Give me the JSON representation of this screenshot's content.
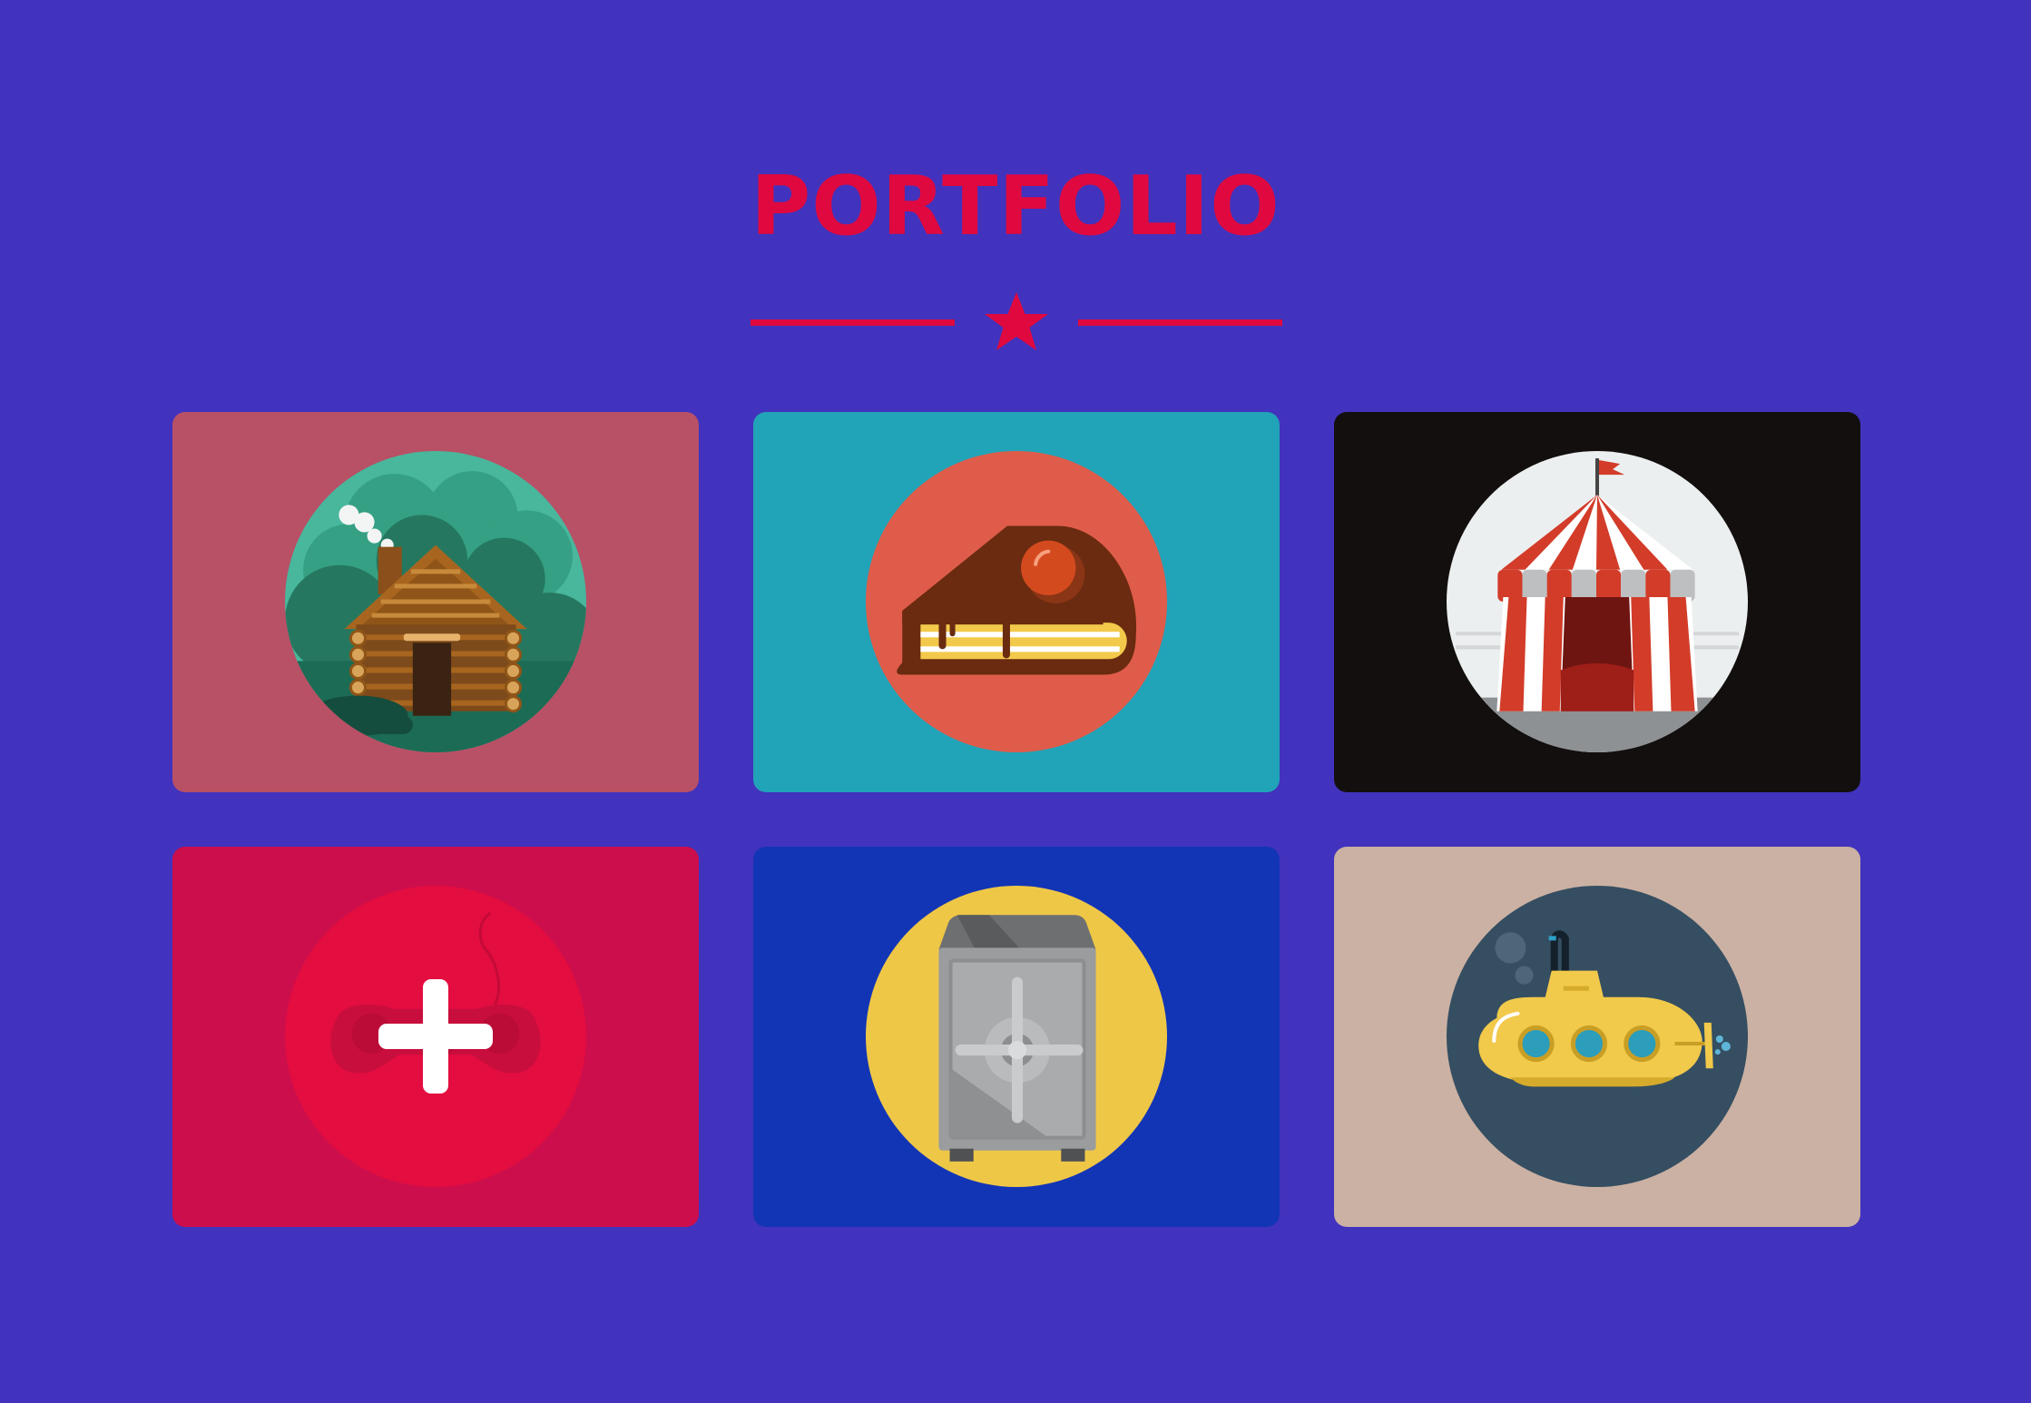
{
  "page": {
    "title": "PORTFOLIO",
    "background_color": "#4133bd",
    "accent_color": "#e0093f"
  },
  "divider": {
    "icon": "star-icon"
  },
  "portfolio": {
    "items": [
      {
        "icon": "log-cabin-icon",
        "card_color": "#b85066",
        "circle_color": "#2a8f72"
      },
      {
        "icon": "cake-slice-icon",
        "card_color": "#21a3b8",
        "circle_color": "#e05c4a"
      },
      {
        "icon": "circus-tent-icon",
        "card_color": "#130f0e",
        "circle_color": "#ecefef"
      },
      {
        "icon": "game-controller-icon",
        "card_color": "#cc0e4c",
        "circle_color": "#e30d40",
        "overlay_icon": "plus-icon"
      },
      {
        "icon": "safe-icon",
        "card_color": "#1235b6",
        "circle_color": "#eec747"
      },
      {
        "icon": "submarine-icon",
        "card_color": "#cbb1a3",
        "circle_color": "#354e61"
      }
    ]
  }
}
